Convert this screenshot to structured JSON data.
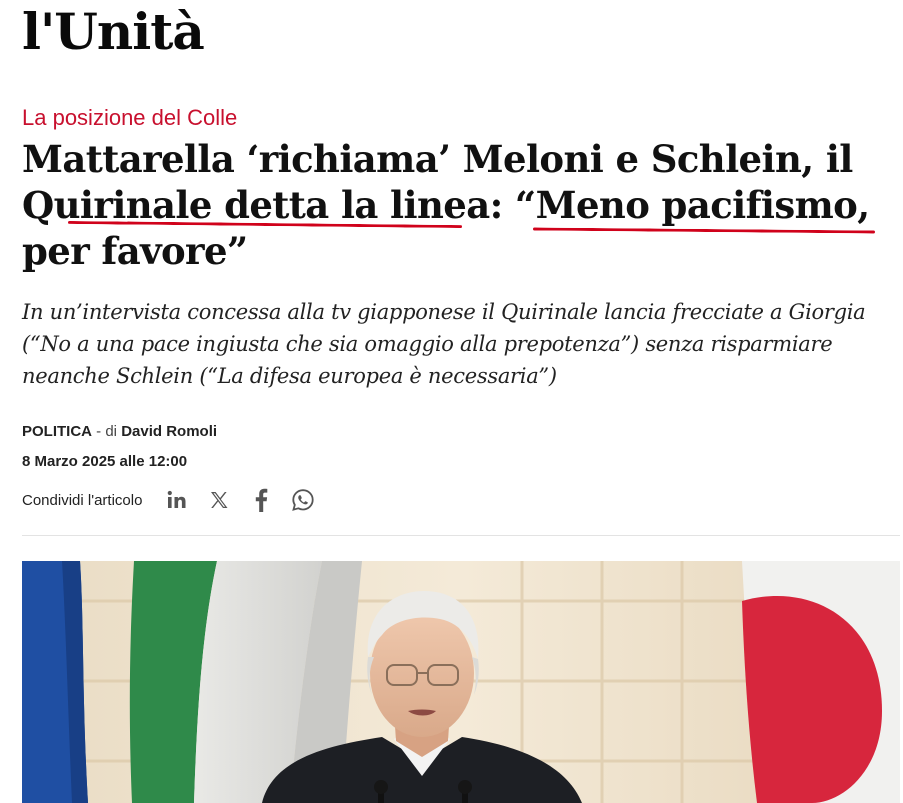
{
  "site": {
    "logo": "l'Unità"
  },
  "article": {
    "kicker": "La posizione del Colle",
    "headline_lines": [
      "Mattarella ‘richiama’ Meloni e Schlein, il",
      "Quirinale detta la linea: “Meno pacifismo,",
      "per favore”"
    ],
    "subtitle_lines": [
      "In un’intervista concessa alla tv giapponese il Quirinale lancia frecciate a Giorgia",
      "(“No a una pace ingiusta che sia omaggio alla prepotenza”) senza risparmiare",
      "neanche Schlein (“La difesa europea è necessaria”)"
    ],
    "section": "POLITICA",
    "byline_sep": " - di ",
    "author": "David Romoli",
    "date": "8 Marzo 2025 alle 12:00",
    "share_label": "Condividi l'articolo"
  },
  "share_icons": [
    "linkedin-icon",
    "x-icon",
    "facebook-icon",
    "whatsapp-icon"
  ],
  "colors": {
    "kicker": "#c8102e",
    "underline": "#d0021b",
    "icons": "#555555"
  }
}
